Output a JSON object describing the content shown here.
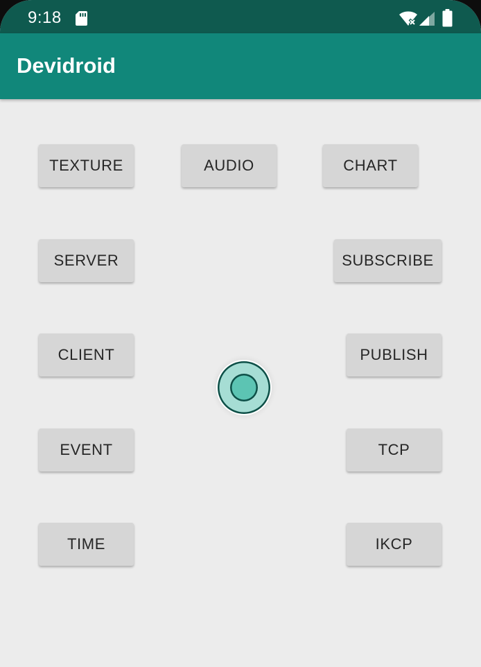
{
  "status_bar": {
    "time": "9:18",
    "bg_color": "#0f5a4f",
    "icons": [
      "sd-card-icon",
      "wifi-off-icon",
      "signal-icon",
      "battery-icon"
    ]
  },
  "app_bar": {
    "title": "Devidroid",
    "bg_color": "#11877a"
  },
  "buttons": {
    "texture": "TEXTURE",
    "audio": "AUDIO",
    "chart": "CHART",
    "server": "SERVER",
    "subscribe": "SUBSCRIBE",
    "client": "CLIENT",
    "publish": "PUBLISH",
    "event": "EVENT",
    "tcp": "TCP",
    "time": "TIME",
    "ikcp": "IKCP"
  },
  "floating_button": {
    "icon": "floating-ball-icon",
    "accent": "#5cc4b3"
  }
}
